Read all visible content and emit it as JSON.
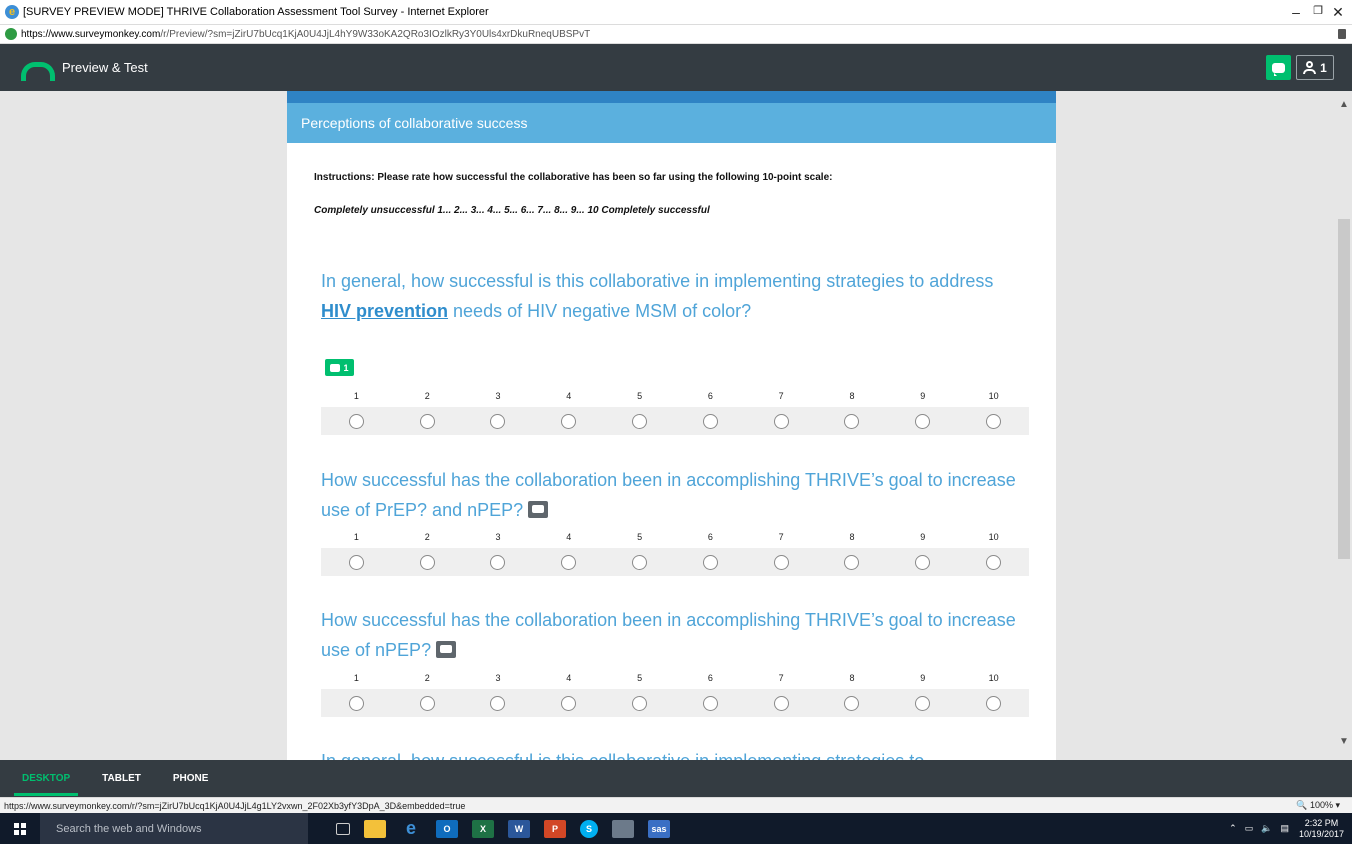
{
  "browser": {
    "title": "[SURVEY PREVIEW MODE] THRIVE Collaboration Assessment Tool Survey - Internet Explorer",
    "url_host": "https://www.surveymonkey.com",
    "url_path": "/r/Preview/?sm=jZirU7bUcq1KjA0U4JjL4hY9W33oKA2QRo3IOzlkRy3Y0Uls4xrDkuRneqUBSPvT",
    "status_url": "https://www.surveymonkey.com/r/?sm=jZirU7bUcq1KjA0U4JjL4g1LY2vxwn_2F02Xb3yfY3DpA_3D&embedded=true",
    "zoom": "100%"
  },
  "toolbar": {
    "title": "Preview & Test",
    "user_count": "1"
  },
  "page": {
    "title": "Perceptions of collaborative success",
    "instructions": "Instructions: Please rate how successful the collaborative has been so far using the following 10-point scale:",
    "scale_legend": "Completely unsuccessful  1... 2... 3... 4... 5... 6... 7... 8... 9... 10 Completely successful"
  },
  "questions": [
    {
      "text_before": "In general, how successful is this collaborative in implementing strategies to address ",
      "link": "HIV prevention",
      "text_after": " needs of HIV negative MSM of color?",
      "comment_count": "1"
    },
    {
      "text": "How successful has the collaboration been in accomplishing THRIVE’s goal to increase use of PrEP? and nPEP?"
    },
    {
      "text": "How successful has the collaboration been in accomplishing THRIVE’s goal to increase use of nPEP?"
    },
    {
      "text": "In general, how successful is this collaborative in implementing strategies to"
    }
  ],
  "scale": {
    "labels": [
      "1",
      "2",
      "3",
      "4",
      "5",
      "6",
      "7",
      "8",
      "9",
      "10"
    ]
  },
  "device_tabs": {
    "desktop": "DESKTOP",
    "tablet": "TABLET",
    "phone": "PHONE"
  },
  "taskbar": {
    "search_placeholder": "Search the web and Windows",
    "time": "2:32 PM",
    "date": "10/19/2017"
  },
  "colors": {
    "brand_green": "#00bf6f",
    "header_dark": "#343c42",
    "question_blue": "#4fa4d8",
    "page_bar_blue": "#5bb0de"
  }
}
